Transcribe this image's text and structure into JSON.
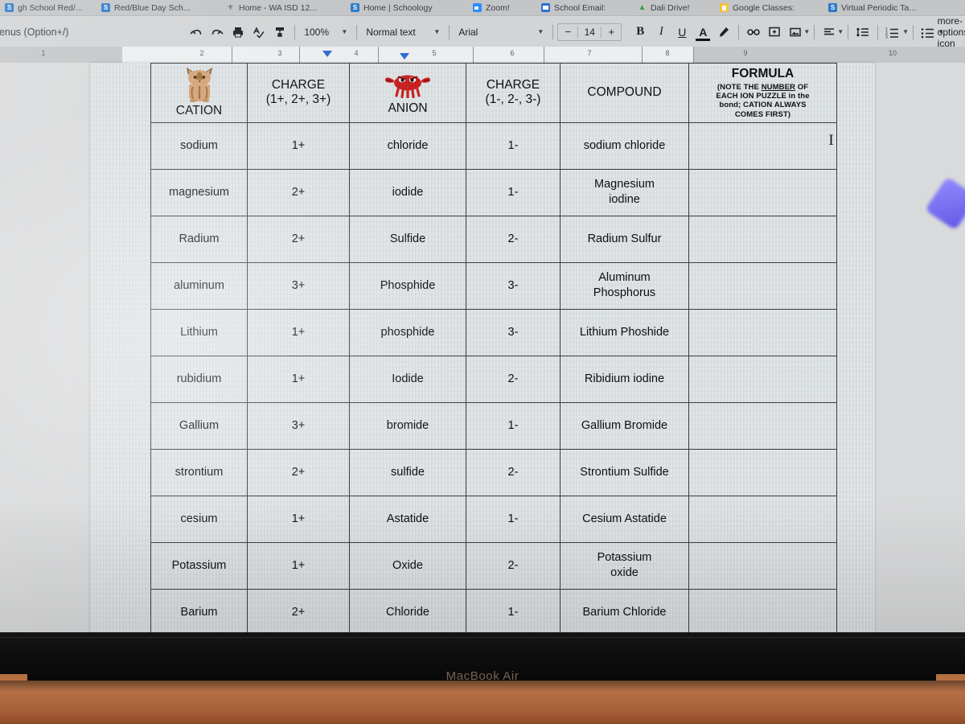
{
  "browser": {
    "tabs": [
      {
        "label": "gh School Red/...",
        "icon": "school-favicon"
      },
      {
        "label": "Red/Blue Day Sch...",
        "icon": "schoology-favicon"
      },
      {
        "label": "Home - WA ISD 12...",
        "icon": "district-favicon"
      },
      {
        "label": "Home | Schoology",
        "icon": "schoology-favicon"
      },
      {
        "label": "Zoom!",
        "icon": "zoom-favicon"
      },
      {
        "label": "School Email:",
        "icon": "mail-favicon"
      },
      {
        "label": "Dali Drive!",
        "icon": "drive-favicon"
      },
      {
        "label": "Google Classes:",
        "icon": "classroom-favicon"
      },
      {
        "label": "Virtual Periodic Ta...",
        "icon": "schoology-favicon"
      }
    ]
  },
  "toolbar": {
    "menu_hint": "henus (Option+/)",
    "undo": "undo-icon",
    "redo": "redo-icon",
    "print": "print-icon",
    "spellcheck": "spellcheck-icon",
    "paint_format": "paint-format-icon",
    "zoom_value": "100%",
    "style_value": "Normal text",
    "font_value": "Arial",
    "font_size_decrease": "−",
    "font_size_value": "14",
    "font_size_increase": "+",
    "bold": "B",
    "italic": "I",
    "underline": "U",
    "text_color": "A",
    "highlight": "highlight-pen-icon",
    "link": "link-icon",
    "comment": "add-comment-icon",
    "image": "insert-image-icon",
    "align": "align-icon",
    "line_spacing": "line-spacing-icon",
    "numbered_list": "numbered-list-icon",
    "bulleted_list": "bulleted-list-icon",
    "more": "more-options-icon"
  },
  "ruler": {
    "numbers": [
      "1",
      "2",
      "3",
      "4",
      "5",
      "6",
      "7",
      "8",
      "9",
      "10"
    ]
  },
  "document": {
    "table": {
      "headers": [
        {
          "image": "cation-cat-image",
          "label": "CATION"
        },
        {
          "label": "CHARGE",
          "sub": "(1+, 2+, 3+)"
        },
        {
          "image": "anion-crab-image",
          "label": "ANION"
        },
        {
          "label": "CHARGE",
          "sub": "(1-, 2-, 3-)"
        },
        {
          "label": "COMPOUND"
        },
        {
          "label": "FORMULA",
          "note_1": "(NOTE THE ",
          "note_underlined": "NUMBER",
          "note_2": " OF",
          "note_3": "EACH ION  PUZZLE in the",
          "note_4": "bond; CATION  ALWAYS",
          "note_5": "COMES FIRST)"
        }
      ],
      "rows": [
        {
          "cation": "sodium",
          "cation_charge": "1+",
          "anion": "chloride",
          "anion_charge": "1-",
          "compound": "sodium chloride",
          "formula": ""
        },
        {
          "cation": "magnesium",
          "cation_charge": "2+",
          "anion": "iodide",
          "anion_charge": "1-",
          "compound": "Magnesium\niodine",
          "formula": ""
        },
        {
          "cation": "Radium",
          "cation_charge": "2+",
          "anion": "Sulfide",
          "anion_charge": "2-",
          "compound": "Radium Sulfur",
          "formula": ""
        },
        {
          "cation": "aluminum",
          "cation_charge": "3+",
          "anion": "Phosphide",
          "anion_charge": "3-",
          "compound": "Aluminum\nPhosphorus",
          "formula": ""
        },
        {
          "cation": "Lithium",
          "cation_charge": "1+",
          "anion": "phosphide",
          "anion_charge": "3-",
          "compound": "Lithium Phoshide",
          "formula": ""
        },
        {
          "cation": "rubidium",
          "cation_charge": "1+",
          "anion": "Iodide",
          "anion_charge": "2-",
          "compound": "Ribidium iodine",
          "formula": ""
        },
        {
          "cation": "Gallium",
          "cation_charge": "3+",
          "anion": "bromide",
          "anion_charge": "1-",
          "compound": "Gallium Bromide",
          "formula": ""
        },
        {
          "cation": "strontium",
          "cation_charge": "2+",
          "anion": "sulfide",
          "anion_charge": "2-",
          "compound": "Strontium Sulfide",
          "formula": ""
        },
        {
          "cation": "cesium",
          "cation_charge": "1+",
          "anion": "Astatide",
          "anion_charge": "1-",
          "compound": "Cesium Astatide",
          "formula": ""
        },
        {
          "cation": "Potassium",
          "cation_charge": "1+",
          "anion": "Oxide",
          "anion_charge": "2-",
          "compound": "Potassium\noxide",
          "formula": ""
        },
        {
          "cation": "Barium",
          "cation_charge": "2+",
          "anion": "Chloride",
          "anion_charge": "1-",
          "compound": "Barium Chloride",
          "formula": ""
        }
      ]
    }
  },
  "laptop": {
    "brand": "MacBook Air"
  },
  "colors": {
    "accent": "#2b6cd4",
    "page_background": "#e3e4e5",
    "toolbar_background": "#d2d4d6",
    "table_border": "#3c3c3c",
    "desk": "#b5703f"
  }
}
